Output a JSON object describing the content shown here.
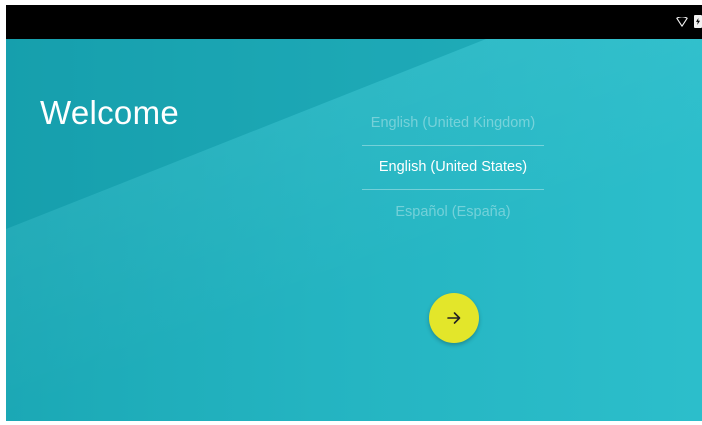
{
  "welcome": {
    "title": "Welcome"
  },
  "languages": {
    "items": [
      {
        "label": "English (United Kingdom)",
        "state": "dim"
      },
      {
        "label": "English (United States)",
        "state": "selected"
      },
      {
        "label": "Español (España)",
        "state": "dim"
      }
    ]
  },
  "next_button": {
    "icon": "arrow-right-icon",
    "color": "#e3e62a"
  },
  "status_bar": {
    "icons": [
      "wifi-icon",
      "battery-charging-icon"
    ]
  },
  "colors": {
    "background": "#2bb6c5",
    "status_bar": "#000000"
  }
}
